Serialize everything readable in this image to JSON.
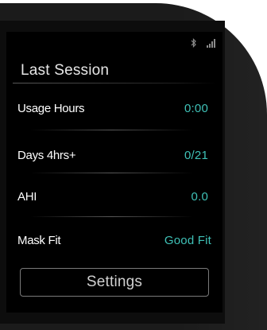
{
  "status": {
    "bluetooth_icon": "bluetooth-icon",
    "signal_icon": "cellular-signal-icon"
  },
  "screen": {
    "title": "Last Session",
    "rows": [
      {
        "label": "Usage Hours",
        "value": "0:00"
      },
      {
        "label": "Days 4hrs+",
        "value": "0/21"
      },
      {
        "label": "AHI",
        "value": "0.0"
      },
      {
        "label": "Mask Fit",
        "value": "Good Fit"
      }
    ],
    "settings_label": "Settings"
  },
  "colors": {
    "accent": "#3fc1b7",
    "screen_background": "#000000",
    "device_body": "#1b1b1b"
  }
}
